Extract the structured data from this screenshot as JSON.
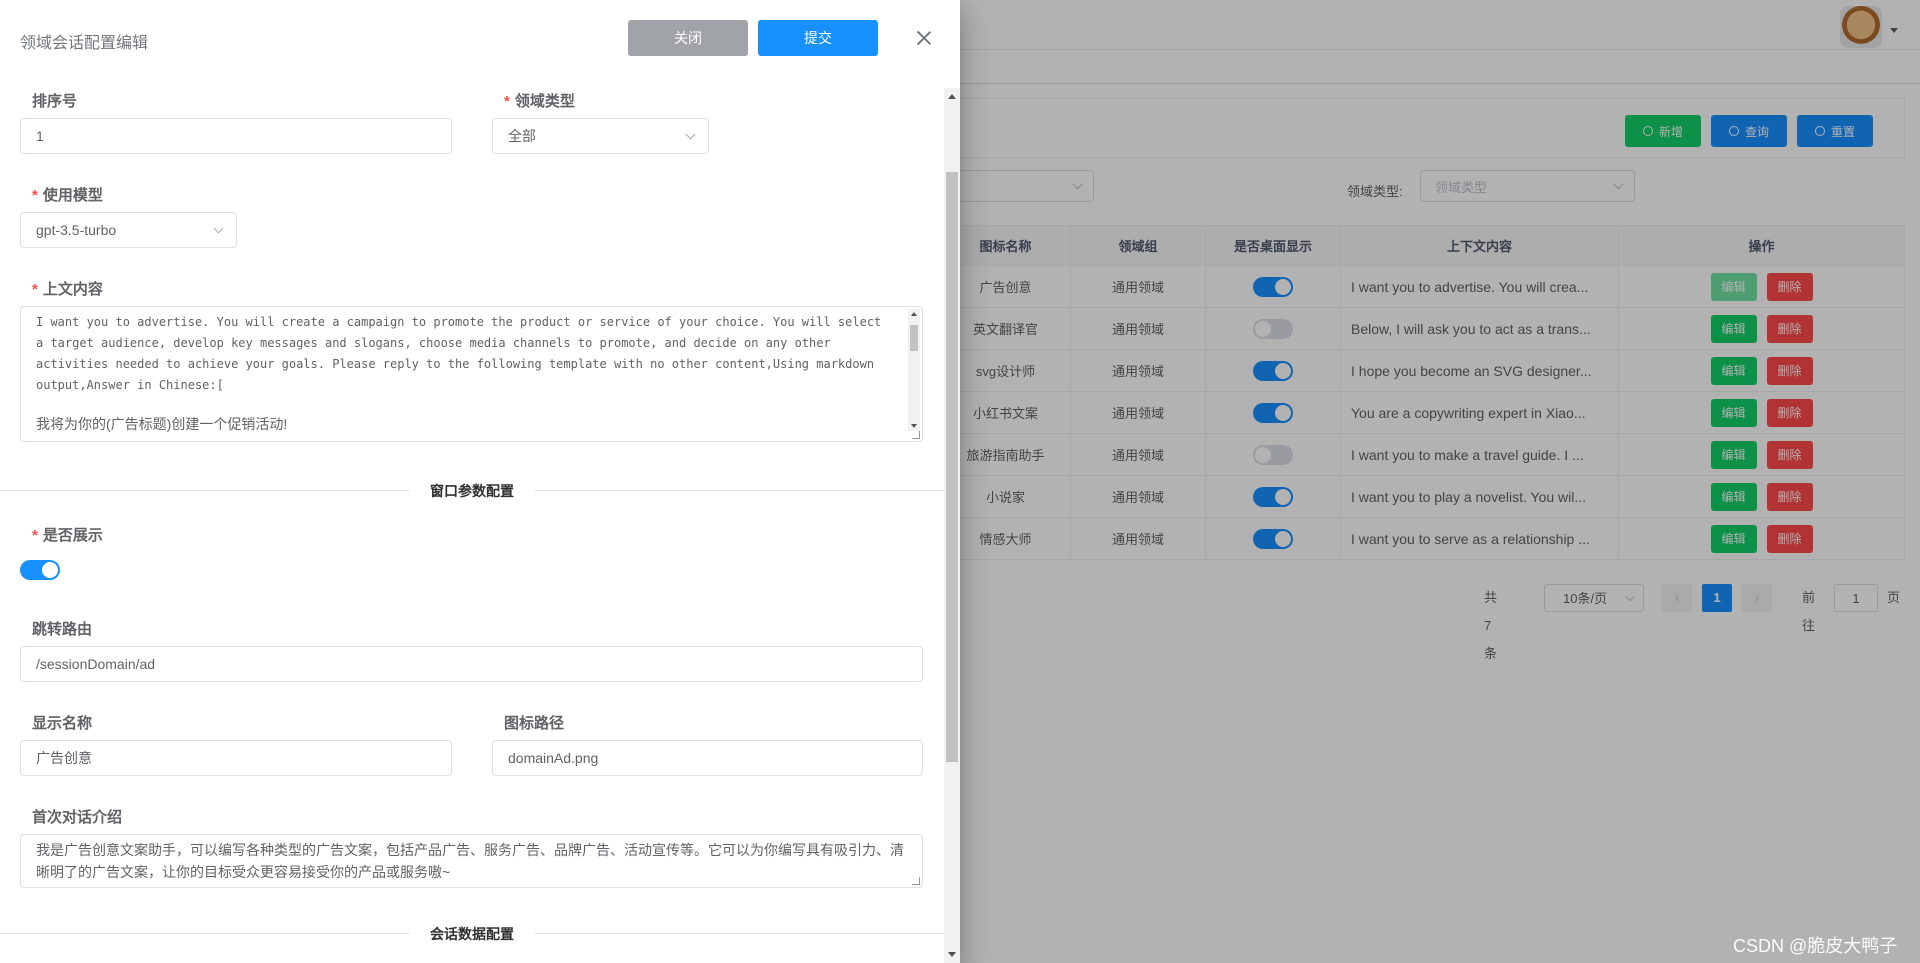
{
  "drawer": {
    "title": "领域会话配置编辑",
    "close_label": "关闭",
    "submit_label": "提交"
  },
  "form": {
    "sort_label": "排序号",
    "sort_value": "1",
    "domain_type_label": "领域类型",
    "domain_type_value": "全部",
    "model_label": "使用模型",
    "model_value": "gpt-3.5-turbo",
    "context_label": "上文内容",
    "context_value_en": "I want you to advertise. You will create a campaign to promote the product or service of your choice. You will select a target audience, develop key messages and slogans, choose media channels to promote, and decide on any other activities needed to achieve your goals. Please reply to the following template with no other content,Using markdown output,Answer in Chinese:[",
    "context_value_cn": "我将为你的(广告标题)创建一个促销活动!",
    "section_window": "窗口参数配置",
    "show_label": "是否展示",
    "show_value": true,
    "route_label": "跳转路由",
    "route_value": "/sessionDomain/ad",
    "display_name_label": "显示名称",
    "display_name_value": "广告创意",
    "icon_path_label": "图标路径",
    "icon_path_value": "domainAd.png",
    "intro_label": "首次对话介绍",
    "intro_value": "我是广告创意文案助手，可以编写各种类型的广告文案，包括产品广告、服务广告、品牌广告、活动宣传等。它可以为你编写具有吸引力、清晰明了的广告文案，让你的目标受众更容易接受你的产品或服务嗷~",
    "section_session": "会话数据配置"
  },
  "toolbar": {
    "add_label": "新增",
    "query_label": "查询",
    "reset_label": "重置"
  },
  "filter": {
    "domain_type_label": "领域类型:",
    "domain_type_placeholder": "领域类型"
  },
  "table": {
    "headers": [
      "图标名称",
      "领域组",
      "是否桌面显示",
      "上下文内容",
      "操作"
    ],
    "edit_label": "编辑",
    "delete_label": "删除",
    "rows": [
      {
        "name": "广告创意",
        "group": "通用领域",
        "desktop": true,
        "context": "I want you to advertise. You will crea..."
      },
      {
        "name": "英文翻译官",
        "group": "通用领域",
        "desktop": false,
        "context": "Below, I will ask you to act as a trans..."
      },
      {
        "name": "svg设计师",
        "group": "通用领域",
        "desktop": true,
        "context": "I hope you become an SVG designer..."
      },
      {
        "name": "小红书文案",
        "group": "通用领域",
        "desktop": true,
        "context": "You are a copywriting expert in Xiao..."
      },
      {
        "name": "旅游指南助手",
        "group": "通用领域",
        "desktop": false,
        "context": "I want you to make a travel guide. I ..."
      },
      {
        "name": "小说家",
        "group": "通用领域",
        "desktop": true,
        "context": "I want you to play a novelist. You wil..."
      },
      {
        "name": "情感大师",
        "group": "通用领域",
        "desktop": true,
        "context": "I want you to serve as a relationship ..."
      }
    ]
  },
  "pager": {
    "total": "共 7 条",
    "page_size": "10条/页",
    "current": "1",
    "goto_label": "前往",
    "goto_value": "1",
    "page_suffix": "页"
  },
  "watermark": "CSDN @脆皮大鸭子",
  "colors": {
    "primary": "#1890ff",
    "success": "#13ce66",
    "danger": "#ff4949",
    "muted_button": "#a0a3a8"
  }
}
